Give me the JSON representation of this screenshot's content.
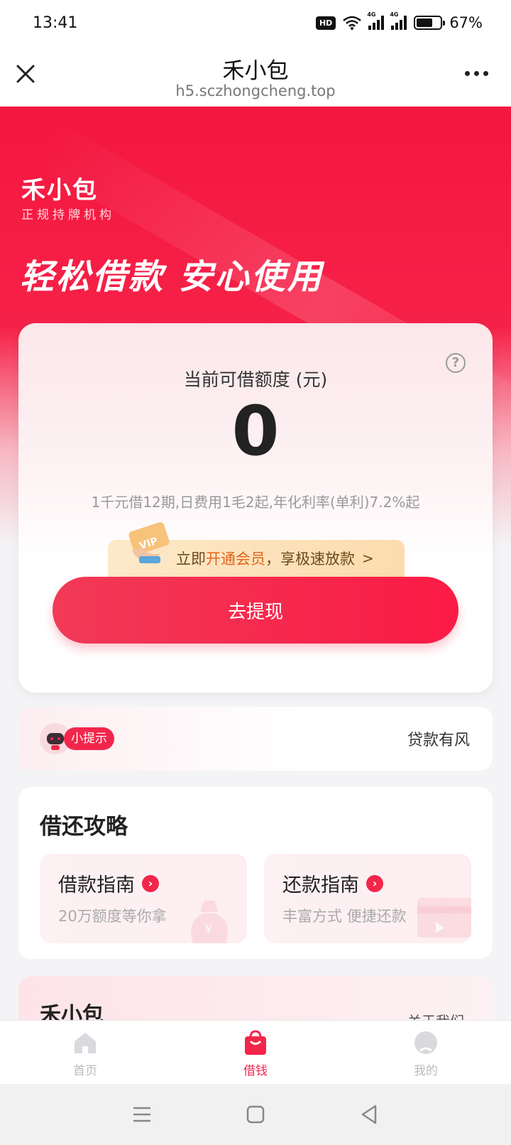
{
  "status": {
    "time": "13:41",
    "battery": "67%",
    "battery_level": 0.67,
    "network": "4G",
    "hd": "HD"
  },
  "titlebar": {
    "title": "禾小包",
    "url": "h5.sczhongcheng.top"
  },
  "hero": {
    "brand": "禾小包",
    "brand_sub": "正规持牌机构",
    "slogan": "轻松借款 安心使用"
  },
  "quota": {
    "label": "当前可借额度 (元)",
    "value": "0",
    "description": "1千元借12期,日费用1毛2起,年化利率(单利)7.2%起",
    "help_symbol": "?"
  },
  "vip": {
    "prefix": "立即",
    "highlight": "开通会员",
    "suffix": "，享极速放款",
    "chevron": ">",
    "ticket_text": "VIP"
  },
  "withdraw_button": "去提现",
  "tip": {
    "badge": "小提示",
    "text": "贷款有风"
  },
  "guide": {
    "title": "借还攻略",
    "items": [
      {
        "title": "借款指南",
        "subtitle": "20万额度等你拿"
      },
      {
        "title": "还款指南",
        "subtitle": "丰富方式 便捷还款"
      }
    ]
  },
  "brand_card": {
    "title": "禾小包",
    "link": "关于我们"
  },
  "tabs": [
    {
      "label": "首页",
      "icon": "home-icon"
    },
    {
      "label": "借钱",
      "icon": "bag-icon"
    },
    {
      "label": "我的",
      "icon": "profile-icon"
    }
  ],
  "colors": {
    "brand_red": "#f2264b",
    "vip_gold": "#e2641b"
  }
}
